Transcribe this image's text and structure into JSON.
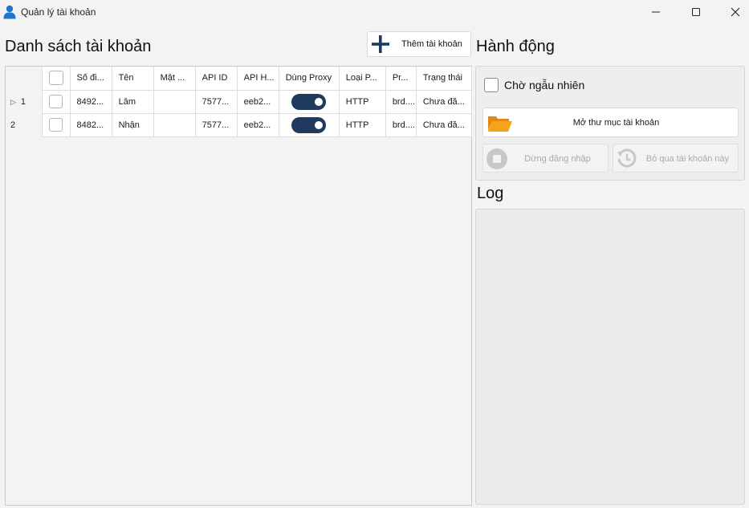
{
  "window": {
    "title": "Quản lý tài khoản",
    "icon": "user-icon"
  },
  "accounts": {
    "heading": "Danh sách tài khoản",
    "add_button": "Thêm tài khoản",
    "columns": [
      "Số đi...",
      "Tên",
      "Mật ...",
      "API ID",
      "API H...",
      "Dùng Proxy",
      "Loại P...",
      "Pr...",
      "Trạng thái"
    ],
    "rows": [
      {
        "index": "1",
        "selected": false,
        "phone": "8492...",
        "name": "Lâm",
        "password": "",
        "api_id": "7577...",
        "api_hash": "eeb2...",
        "use_proxy": true,
        "proxy_type": "HTTP",
        "proxy": "brd....",
        "status": "Chưa đă..."
      },
      {
        "index": "2",
        "selected": false,
        "phone": "8482...",
        "name": "Nhận",
        "password": "",
        "api_id": "7577...",
        "api_hash": "eeb2...",
        "use_proxy": true,
        "proxy_type": "HTTP",
        "proxy": "brd....",
        "status": "Chưa đă..."
      }
    ]
  },
  "actions": {
    "heading": "Hành động",
    "random_wait_label": "Chờ ngẫu nhiên",
    "random_wait_checked": false,
    "open_folder_button": "Mở thư mục tài khoản",
    "stop_login_button": "Dừng đăng nhập",
    "skip_account_button": "Bỏ qua tài khoản này"
  },
  "log": {
    "heading": "Log"
  },
  "colors": {
    "toggle_on": "#1f3a5c",
    "add_icon": "#1f3a5c",
    "folder": "#f7a21b"
  }
}
